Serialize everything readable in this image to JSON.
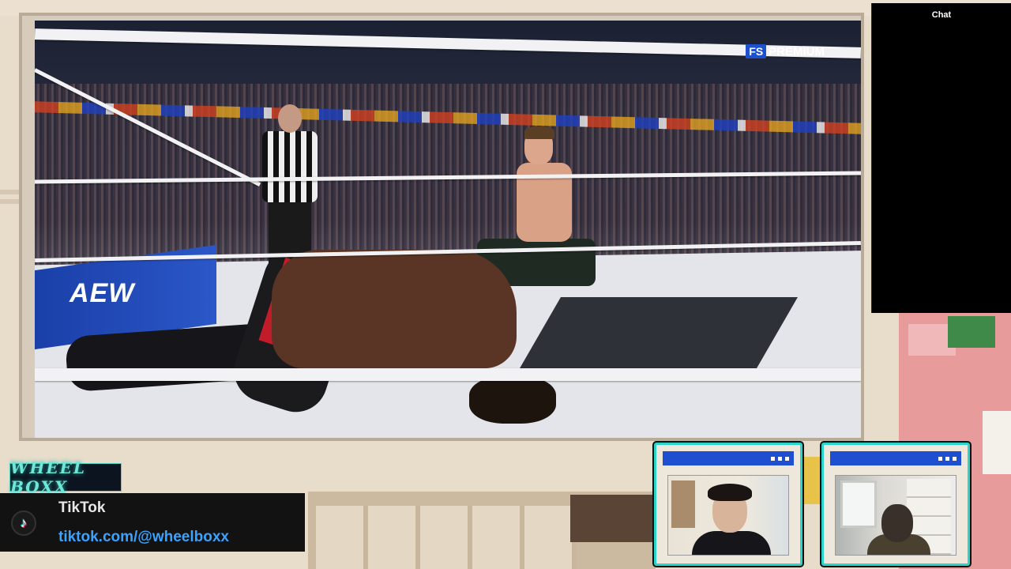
{
  "stream": {
    "broadcast_badge": {
      "network_mark": "FS",
      "label": "PREMIUM"
    },
    "apron_logo": "AEW"
  },
  "chat": {
    "title": "Chat"
  },
  "brand": {
    "logo_text": "WHEEL BOXX"
  },
  "tiktok": {
    "icon": "tiktok-icon",
    "title": "TikTok",
    "link": "tiktok.com/@wheelboxx"
  },
  "webcams": [
    {
      "name": "webcam-host-1",
      "icon": "window-dots-icon"
    },
    {
      "name": "webcam-host-2",
      "icon": "window-dots-icon"
    }
  ],
  "colors": {
    "cam_border": "#2ad4c8",
    "cam_bar": "#1e4fd1",
    "tiktok_link": "#3aa2ff",
    "brand_glow": "#6fe6d8"
  }
}
